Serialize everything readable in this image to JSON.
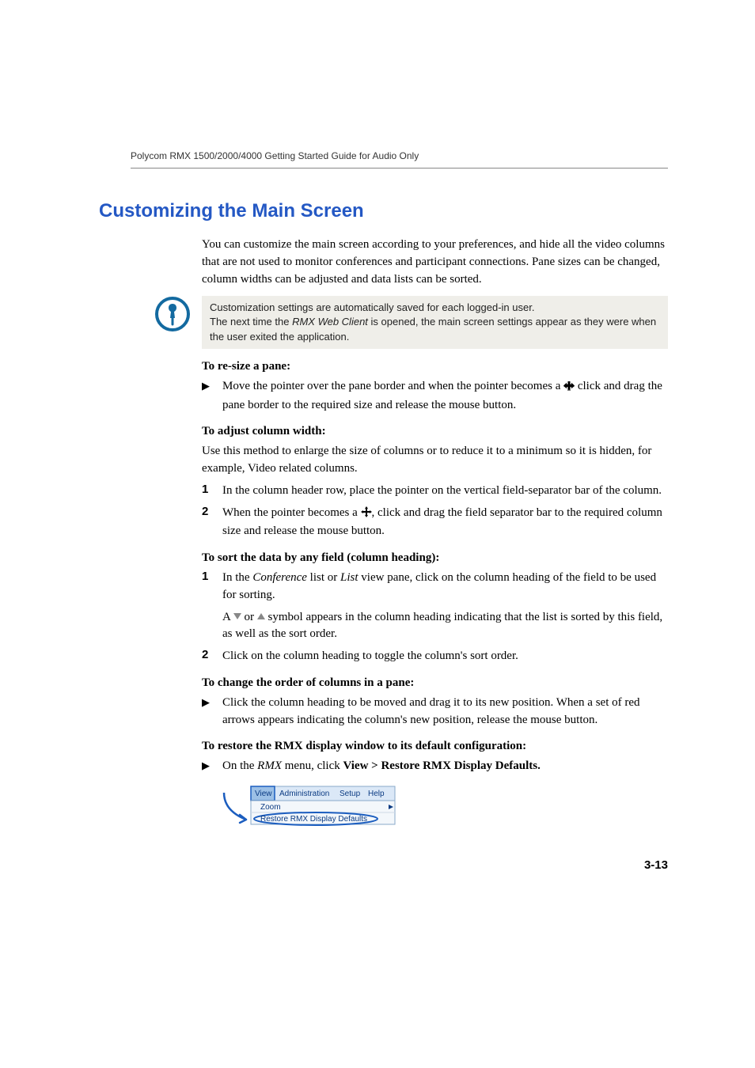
{
  "header": "Polycom RMX 1500/2000/4000 Getting Started Guide for Audio Only",
  "section_title": "Customizing the Main Screen",
  "intro": "You can customize the main screen according to your preferences, and hide all the video columns that are not used to monitor conferences and participant connections. Pane sizes can be changed, column widths can be adjusted and data lists can be sorted.",
  "note": {
    "line1": "Customization settings are automatically saved for each logged-in user.",
    "line2a": "The next time the ",
    "line2em": "RMX Web Client",
    "line2b": " is opened, the main screen settings appear as they were when the user exited the application."
  },
  "h_resize": "To re-size a pane:",
  "resize_item_a": "Move the pointer over the pane border and when the pointer becomes a ",
  "resize_item_b": " click and drag the pane border to the required size and release the mouse button.",
  "h_width": "To adjust column width:",
  "width_para": "Use this method to enlarge the size of columns or to reduce it to a minimum so it is hidden, for example, Video related columns.",
  "width_1": "In the column header row, place the pointer on the vertical field-separator bar of the column.",
  "width_2a": "When the pointer becomes a ",
  "width_2b": ", click and drag the field separator bar to the required column size and release the mouse button.",
  "h_sort": "To sort the data by any field (column heading):",
  "sort_1a": "In the ",
  "sort_1em1": "Conference",
  "sort_1b": " list or ",
  "sort_1em2": "List",
  "sort_1c": " view pane, click on the column heading of the field to be used for sorting.",
  "sort_sub_a": "A ",
  "sort_sub_b": " or ",
  "sort_sub_c": " symbol appears in the column heading indicating that the list is sorted by this field, as well as the sort order.",
  "sort_2": "Click on the column heading to toggle the column's sort order.",
  "h_order": "To change the order of columns in a pane:",
  "order_item": "Click the column heading to be moved and drag it to its new position. When a set of red arrows appears indicating the column's new position, release the mouse button.",
  "h_restore": "To restore the RMX display window to its default configuration:",
  "restore_a": "On the ",
  "restore_em": "RMX",
  "restore_b": " menu, click ",
  "restore_bold": "View > Restore RMX Display Defaults.",
  "menu": {
    "view": "View",
    "admin": "Administration",
    "setup": "Setup",
    "help": "Help",
    "zoom": "Zoom",
    "restore": "Restore RMX Display Defaults"
  },
  "pagenum": "3-13"
}
